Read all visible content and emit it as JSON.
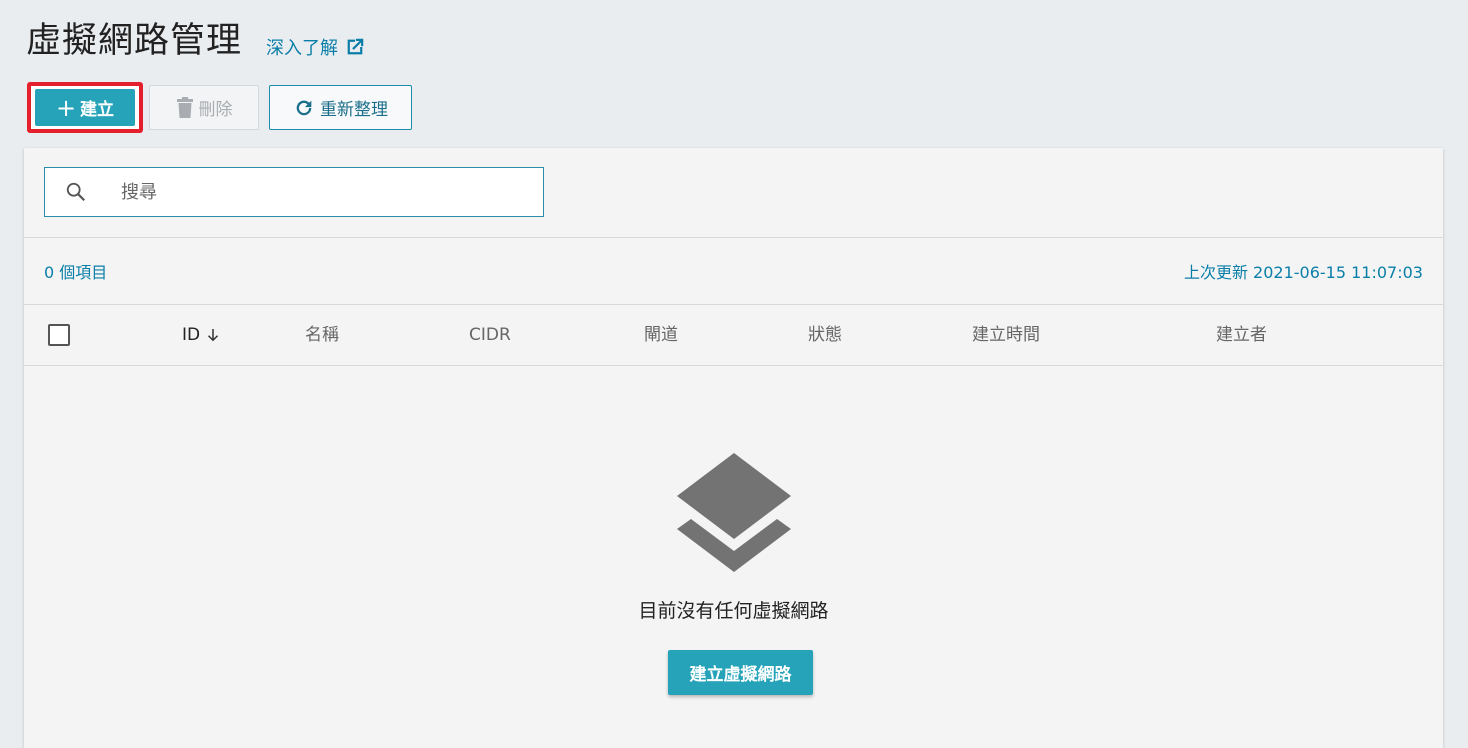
{
  "header": {
    "title": "虛擬網路管理",
    "learn_more": "深入了解"
  },
  "toolbar": {
    "create_label": "建立",
    "delete_label": "刪除",
    "refresh_label": "重新整理"
  },
  "search": {
    "placeholder": "搜尋",
    "value": ""
  },
  "meta": {
    "item_count": "0 個項目",
    "last_updated": "上次更新 2021-06-15 11:07:03"
  },
  "table": {
    "columns": [
      "ID",
      "名稱",
      "CIDR",
      "閘道",
      "狀態",
      "建立時間",
      "建立者"
    ]
  },
  "empty_state": {
    "message": "目前沒有任何虛擬網路",
    "button": "建立虛擬網路"
  },
  "colors": {
    "accent": "#26a3b9",
    "link": "#0a7ea8",
    "highlight": "#e3202b"
  }
}
